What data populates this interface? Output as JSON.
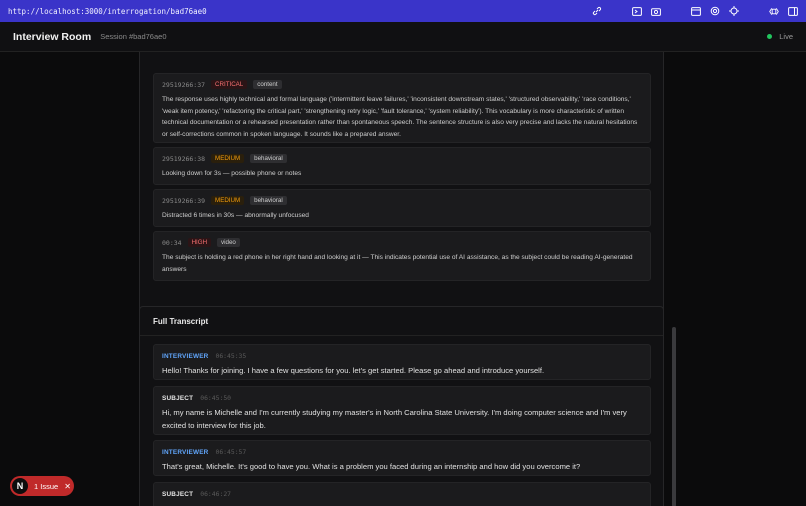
{
  "browser": {
    "url": "http://localhost:3000/interrogation/bad76ae0"
  },
  "header": {
    "title": "Interview Room",
    "session": "Session #bad76ae0",
    "status": "Live"
  },
  "flags": [
    {
      "timestamp": "29519266:37",
      "severity": "CRITICAL",
      "category": "content",
      "text": "The response uses highly technical and formal language ('intermittent leave failures,' 'inconsistent downstream states,' 'structured observability,' 'race conditions,' 'weak item potency,' 'refactoring the critical part,' 'strengthening retry logic,' 'fault tolerance,' 'system reliability'). This vocabulary is more characteristic of written technical documentation or a rehearsed presentation rather than spontaneous speech. The sentence structure is also very precise and lacks the natural hesitations or self-corrections common in spoken language. It sounds like a prepared answer."
    },
    {
      "timestamp": "29519266:38",
      "severity": "MEDIUM",
      "category": "behavioral",
      "text": "Looking down for 3s — possible phone or notes"
    },
    {
      "timestamp": "29519266:39",
      "severity": "MEDIUM",
      "category": "behavioral",
      "text": "Distracted 6 times in 30s — abnormally unfocused"
    },
    {
      "timestamp": "00:34",
      "severity": "HIGH",
      "category": "video",
      "text": "The subject is holding a red phone in her right hand and looking at it — This indicates potential use of AI assistance, as the subject could be reading AI-generated answers"
    }
  ],
  "transcript": {
    "title": "Full Transcript",
    "turns": [
      {
        "speaker": "INTERVIEWER",
        "time": "06:45:35",
        "text": "Hello! Thanks for joining. I have a few questions for you. let's get started. Please go ahead and introduce yourself."
      },
      {
        "speaker": "SUBJECT",
        "time": "06:45:50",
        "text": "Hi, my name is Michelle and I'm currently studying my master's in North Carolina State University. I'm doing computer science and I'm very excited to interview for this job."
      },
      {
        "speaker": "INTERVIEWER",
        "time": "06:45:57",
        "text": "That's great, Michelle. It's good to have you. What is a problem you faced during an internship and how did you overcome it?"
      },
      {
        "speaker": "SUBJECT",
        "time": "06:46:27",
        "text": ""
      }
    ]
  },
  "issue_badge": {
    "logo": "N",
    "label": "1 Issue",
    "close": "✕"
  },
  "colors": {
    "chrome": "#3a34c9",
    "live": "#22c55e",
    "critical": "#f87171",
    "medium": "#f59e0b",
    "interviewer": "#60a5fa",
    "issue": "#c02a2a"
  }
}
